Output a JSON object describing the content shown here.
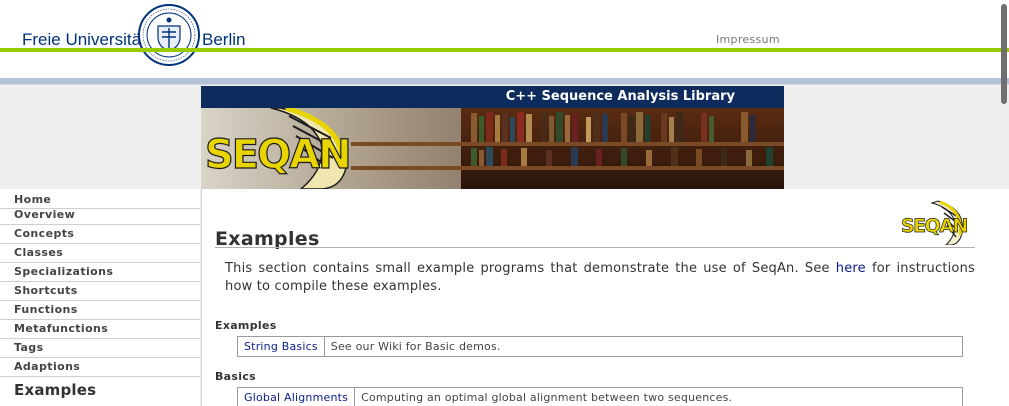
{
  "header": {
    "fu_name_left": "Freie Universität",
    "fu_name_right": "Berlin",
    "impressum": "Impressum",
    "colors": {
      "green": "#99cc00",
      "blue": "#b4c3d9",
      "fu_blue": "#00337a"
    }
  },
  "banner": {
    "title": "C++ Sequence Analysis Library",
    "logo_text": "SEQAN"
  },
  "sidebar": {
    "items": [
      {
        "label": "Home"
      },
      {
        "label": "Overview"
      },
      {
        "label": "Concepts"
      },
      {
        "label": "Classes"
      },
      {
        "label": "Specializations"
      },
      {
        "label": "Shortcuts"
      },
      {
        "label": "Functions"
      },
      {
        "label": "Metafunctions"
      },
      {
        "label": "Tags"
      },
      {
        "label": "Adaptions"
      },
      {
        "label": "Examples"
      }
    ]
  },
  "main": {
    "title": "Examples",
    "intro_before": "This section contains small example programs that demonstrate the use of SeqAn. See ",
    "intro_link": "here",
    "intro_after": " for instructions how to compile these examples.",
    "sections": [
      {
        "heading": "Examples",
        "rows": [
          {
            "link": "String Basics",
            "desc": "See our Wiki for Basic demos."
          }
        ]
      },
      {
        "heading": "Basics",
        "rows": [
          {
            "link": "Global Alignments",
            "desc": "Computing an optimal global alignment between two sequences."
          }
        ]
      }
    ]
  }
}
